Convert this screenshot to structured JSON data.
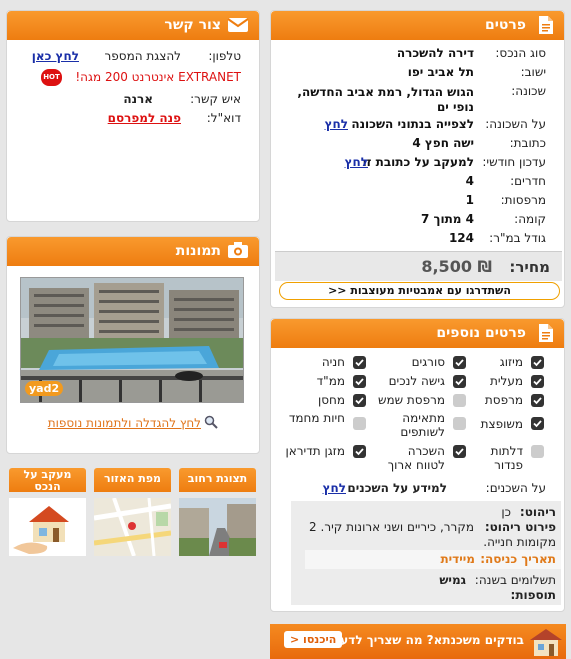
{
  "details": {
    "title": "פרטים",
    "icon": "document-icon",
    "rows": [
      {
        "label": "סוג הנכס:",
        "value": "דירה להשכרה"
      },
      {
        "label": "ישוב:",
        "value": "תל אביב יפו"
      },
      {
        "label": "שכונה:",
        "value": "הגוש הגדול, רמת אביב החדשה, נופי ים"
      },
      {
        "label": "על השכונה:",
        "value": "לצפייה בנתוני השכונה",
        "link": "לחץ"
      },
      {
        "label": "כתובת:",
        "value": "ישה חפץ 4"
      },
      {
        "label": "עדכון חודשי:",
        "value": "למעקב על כתובת זו",
        "link": "לחץ"
      },
      {
        "label": "חדרים:",
        "value": "4"
      },
      {
        "label": "מרפסות:",
        "value": "1"
      },
      {
        "label": "קומה:",
        "value": "4 מתוך 7"
      },
      {
        "label": "גודל במ\"ר:",
        "value": "124"
      }
    ],
    "price_label": "מחיר:",
    "price_value": "8,500 ₪",
    "designer_button": "השתדרגו עם אמבטיות מעוצבות <<"
  },
  "contact": {
    "title": "צור קשר",
    "icon": "envelope-icon",
    "phone_label": "טלפון:",
    "phone_text": "להצגת המספר",
    "phone_link": "לחץ כאן",
    "promo_text": "EXTRANET אינטרנט 200 מגה!",
    "promo_icon": "hot-logo-icon",
    "person_label": "איש קשר:",
    "person_value": "ארנה",
    "email_label": "דוא\"ל:",
    "email_link": "פנה למפרסם"
  },
  "photos": {
    "title": "תמונות",
    "icon": "camera-icon",
    "watermark": "yad2",
    "enlarge_link": "לחץ להגדלה ולתמונות נוספות"
  },
  "tabs": [
    {
      "label": "תצוגת רחוב"
    },
    {
      "label": "מפת האזור"
    },
    {
      "label": "מעקב על הנכס"
    }
  ],
  "extra": {
    "title": "פרטים נוספים",
    "icon": "document-icon",
    "features": [
      {
        "label": "מיזוג",
        "checked": true
      },
      {
        "label": "סורגים",
        "checked": true
      },
      {
        "label": "חניה",
        "checked": true
      },
      {
        "label": "מעלית",
        "checked": true
      },
      {
        "label": "גישה לנכים",
        "checked": true
      },
      {
        "label": "ממ\"ד",
        "checked": true
      },
      {
        "label": "מרפסת",
        "checked": true
      },
      {
        "label": "מרפסת שמש",
        "checked": false
      },
      {
        "label": "מחסן",
        "checked": true
      },
      {
        "label": "משופצת",
        "checked": true
      },
      {
        "label": "מתאימה לשותפים",
        "checked": false
      },
      {
        "label": "חיות מחמד",
        "checked": false
      },
      {
        "label": "דלתות פנדור",
        "checked": false
      },
      {
        "label": "השכרה לטווח ארוך",
        "checked": true
      },
      {
        "label": "מזגן תדיראן",
        "checked": true
      }
    ],
    "neighbors_label": "על השכנים:",
    "neighbors_text": "למידע על השכנים",
    "neighbors_link": "לחץ",
    "furn_label": "ריהוט:",
    "furn_value": "כן",
    "furn_detail_label": "פירוט ריהוט:",
    "furn_detail_value": "מקרר, כיריים ושני ארונות קיר. 2 מקומות חנייה.",
    "entry_label": "תאריך כניסה:",
    "entry_value": "מיידית",
    "payments_label": "תשלומים בשנה:",
    "payments_value": "גמיש",
    "additions_label": "תוספות:"
  },
  "banner": {
    "text": "בודקים משכנתא? מה שצריך לדעת",
    "button": "היכנסו <"
  },
  "colors": {
    "accent": "#f28a1f",
    "link": "#1a2fa8",
    "price_bg": "#e8e8e8"
  }
}
